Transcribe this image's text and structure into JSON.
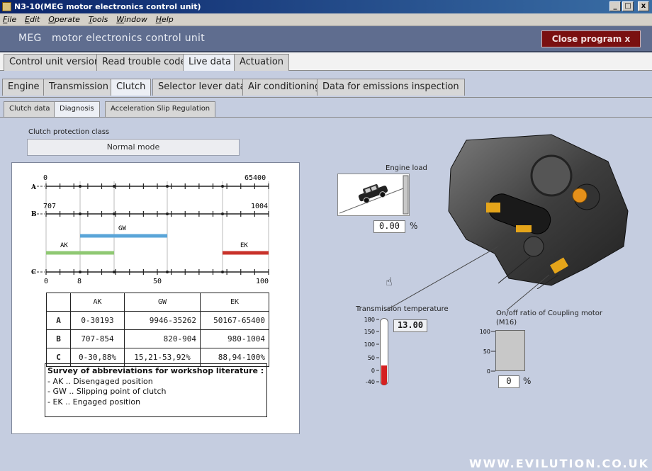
{
  "window": {
    "title": "N3-10(MEG motor electronics control unit)",
    "buttons": [
      "_",
      "□",
      "x"
    ]
  },
  "menu": [
    "File",
    "Edit",
    "Operate",
    "Tools",
    "Window",
    "Help"
  ],
  "header": {
    "brand": "MEG",
    "title": "motor electronics control unit",
    "close_label": "Close program x"
  },
  "tabs_main": [
    {
      "label": "Control unit version",
      "active": false
    },
    {
      "label": "Read trouble code",
      "active": false
    },
    {
      "label": "Live data",
      "active": true
    },
    {
      "label": "Actuation",
      "active": false
    }
  ],
  "tabs_system": [
    {
      "label": "Engine",
      "active": false
    },
    {
      "label": "Transmission",
      "active": false
    },
    {
      "label": "Clutch",
      "active": true
    },
    {
      "label": "Selector lever data",
      "active": false
    },
    {
      "label": "Air conditioning",
      "active": false
    },
    {
      "label": "Data for emissions inspection",
      "active": false
    }
  ],
  "tabs_sub": [
    {
      "label": "Clutch data",
      "active": false
    },
    {
      "label": "Diagnosis",
      "active": true
    },
    {
      "label": "Acceleration Slip Regulation",
      "active": false
    }
  ],
  "protection": {
    "label": "Clutch protection class",
    "value": "Normal mode"
  },
  "diagram": {
    "scale_a": {
      "letter": "A",
      "min": "0",
      "max": "65400"
    },
    "scale_b": {
      "letter": "B",
      "min": "707",
      "max": "1004"
    },
    "scale_c": {
      "letter": "C",
      "min": "0",
      "mid": "50",
      "max": "100",
      "extra": "8"
    },
    "ranges": [
      {
        "name": "GW",
        "color": "#5aa5d8"
      },
      {
        "name": "AK",
        "color": "#8fc873"
      },
      {
        "name": "EK",
        "color": "#c8322a"
      }
    ]
  },
  "table": {
    "headers": [
      "",
      "AK",
      "GW",
      "EK"
    ],
    "rows": [
      [
        "A",
        "0-30193",
        "9946-35262",
        "50167-65400"
      ],
      [
        "B",
        "707-854",
        "820-904",
        "980-1004"
      ],
      [
        "C",
        "0-30,88%",
        "15,21-53,92%",
        "88,94-100%"
      ]
    ]
  },
  "survey": {
    "title": "Survey of abbreviations for workshop literature :",
    "items": [
      "- AK .. Disengaged position",
      "- GW .. Slipping point of clutch",
      "- EK .. Engaged position"
    ]
  },
  "engine_load": {
    "label": "Engine load",
    "value": "0.00",
    "unit": "%",
    "level_percent": 0
  },
  "trans_temp": {
    "label": "Transmission temperature",
    "value": "13.00",
    "ticks": [
      "180",
      "150",
      "100",
      "50",
      "0",
      "-40"
    ],
    "level_celsius": 13
  },
  "coupling": {
    "label": "On/off ratio of Coupling motor",
    "sublabel": "(M16)",
    "value": "0",
    "unit": "%",
    "ticks": [
      "100",
      "50",
      "0"
    ],
    "level_percent": 0
  },
  "watermark": "WWW.EVILUTION.CO.UK"
}
